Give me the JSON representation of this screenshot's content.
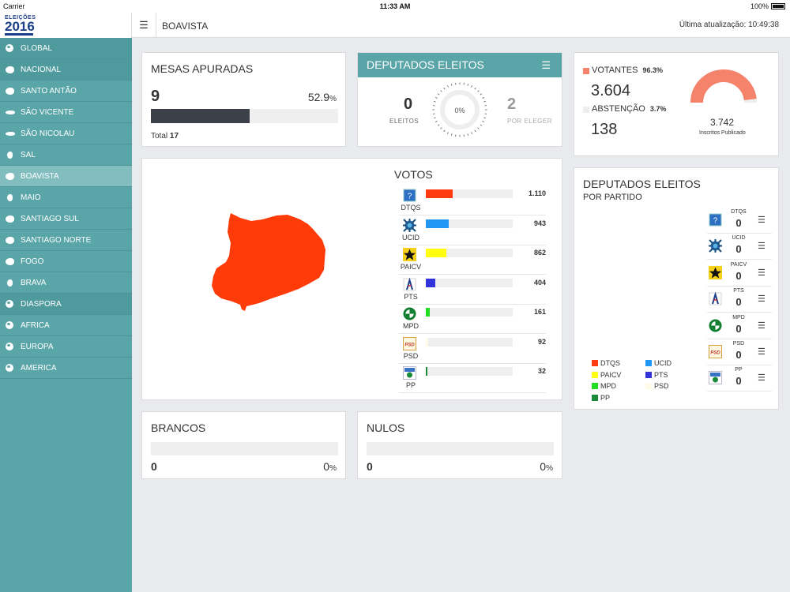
{
  "statusbar": {
    "carrier": "Carrier",
    "time": "11:33 AM",
    "battery": "100%"
  },
  "logo": {
    "small": "ELEIÇÕES",
    "year": "2016"
  },
  "sidebar": {
    "items": [
      {
        "label": "GLOBAL",
        "icon": "globe-icon"
      },
      {
        "label": "NACIONAL",
        "icon": "island-icon"
      },
      {
        "label": "SANTO ANTÃO",
        "icon": "island-icon"
      },
      {
        "label": "SÃO VICENTE",
        "icon": "island-icon"
      },
      {
        "label": "SÃO NICOLAU",
        "icon": "island-icon"
      },
      {
        "label": "SAL",
        "icon": "island-icon"
      },
      {
        "label": "BOAVISTA",
        "icon": "island-icon"
      },
      {
        "label": "MAIO",
        "icon": "island-icon"
      },
      {
        "label": "SANTIAGO SUL",
        "icon": "island-icon"
      },
      {
        "label": "SANTIAGO NORTE",
        "icon": "island-icon"
      },
      {
        "label": "FOGO",
        "icon": "island-icon"
      },
      {
        "label": "BRAVA",
        "icon": "island-icon"
      },
      {
        "label": "DIASPORA",
        "icon": "globe-icon"
      },
      {
        "label": "AFRICA",
        "icon": "globe-icon"
      },
      {
        "label": "EUROPA",
        "icon": "globe-icon"
      },
      {
        "label": "AMERICA",
        "icon": "globe-icon"
      }
    ]
  },
  "header": {
    "title": "BOAVISTA",
    "last_update": "Última atualização: 10:49:38"
  },
  "mesas": {
    "title": "MESAS APURADAS",
    "count": "9",
    "percent": "52.9",
    "percent_sign": "%",
    "fraction": 0.529,
    "total_label": "Total",
    "total": "17"
  },
  "deputados": {
    "title": "DEPUTADOS ELEITOS",
    "eleitos_value": "0",
    "eleitos_label": "ELEITOS",
    "gauge_label": "0%",
    "por_eleger_value": "2",
    "por_eleger_label": "POR ELEGER"
  },
  "votantes": {
    "votantes_label": "VOTANTES",
    "votantes_pct": "96.3%",
    "votantes_value": "3.604",
    "abstencao_label": "ABSTENÇÃO",
    "abstencao_pct": "3.7%",
    "abstencao_value": "138",
    "inscritos_value": "3.742",
    "inscritos_label": "Inscritos Publicado",
    "votantes_color": "#f5826a",
    "abstencao_color": "#eeeeee"
  },
  "votos": {
    "title": "VOTOS",
    "rows": [
      {
        "party": "DTQS",
        "value": "1.110",
        "fraction": 0.3075,
        "color": "#ff3b12"
      },
      {
        "party": "UCID",
        "value": "943",
        "fraction": 0.2612,
        "color": "#2196f3"
      },
      {
        "party": "PAICV",
        "value": "862",
        "fraction": 0.2388,
        "color": "#ffff0f"
      },
      {
        "party": "PTS",
        "value": "404",
        "fraction": 0.1119,
        "color": "#3333dd"
      },
      {
        "party": "MPD",
        "value": "161",
        "fraction": 0.0446,
        "color": "#22dd22"
      },
      {
        "party": "PSD",
        "value": "92",
        "fraction": 0.0255,
        "color": "#fffbe6"
      },
      {
        "party": "PP",
        "value": "32",
        "fraction": 0.0089,
        "color": "#1a8a3a"
      }
    ]
  },
  "brancos": {
    "title": "BRANCOS",
    "value": "0",
    "percent": "0",
    "percent_sign": "%"
  },
  "nulos": {
    "title": "NULOS",
    "value": "0",
    "percent": "0",
    "percent_sign": "%"
  },
  "por_partido": {
    "title": "DEPUTADOS ELEITOS",
    "subtitle": "POR PARTIDO",
    "rows": [
      {
        "party": "DTQS",
        "value": "0"
      },
      {
        "party": "UCID",
        "value": "0"
      },
      {
        "party": "PAICV",
        "value": "0"
      },
      {
        "party": "PTS",
        "value": "0"
      },
      {
        "party": "MPD",
        "value": "0"
      },
      {
        "party": "PSD",
        "value": "0"
      },
      {
        "party": "PP",
        "value": "0"
      }
    ],
    "legend": [
      {
        "name": "DTQS",
        "color": "#ff3b12"
      },
      {
        "name": "UCID",
        "color": "#2196f3"
      },
      {
        "name": "PAICV",
        "color": "#ffff0f"
      },
      {
        "name": "PTS",
        "color": "#3333dd"
      },
      {
        "name": "MPD",
        "color": "#22dd22"
      },
      {
        "name": "PSD",
        "color": "#fffbe6"
      },
      {
        "name": "PP",
        "color": "#1a8a3a"
      }
    ]
  },
  "map": {
    "island": "BOAVISTA",
    "color": "#ff3b0a"
  }
}
